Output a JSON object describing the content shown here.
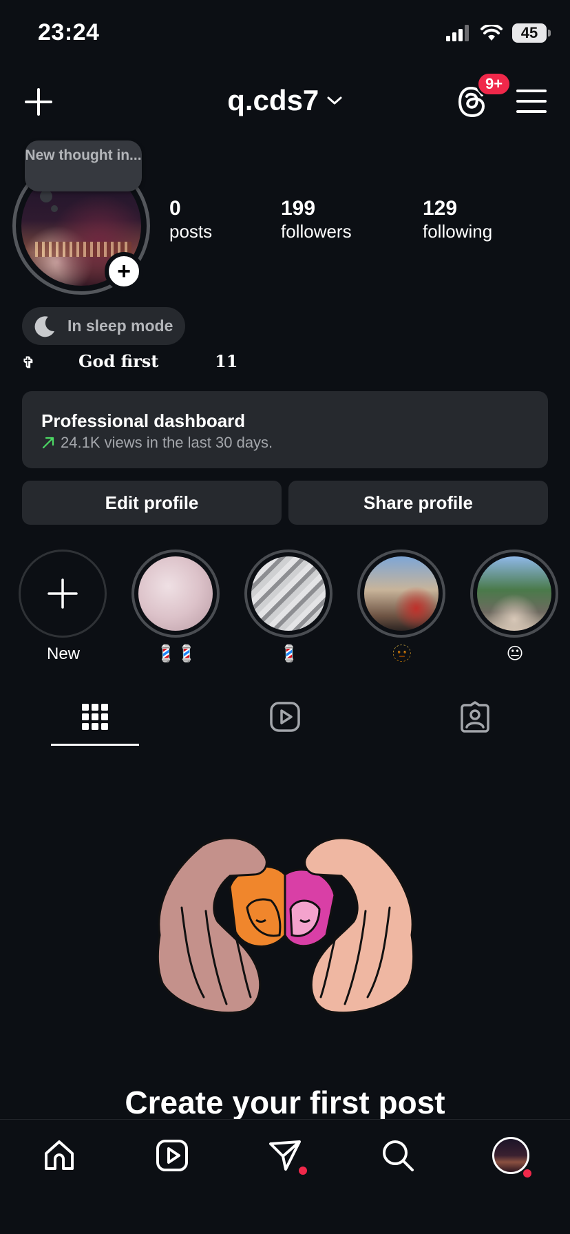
{
  "status_bar": {
    "time": "23:24",
    "battery": "45"
  },
  "header": {
    "username": "q.cds7",
    "notification_badge": "9+"
  },
  "profile": {
    "note": "New thought in...",
    "stats": [
      {
        "value": "0",
        "label": "posts"
      },
      {
        "value": "199",
        "label": "followers"
      },
      {
        "value": "129",
        "label": "following"
      }
    ],
    "sleep_mode": "In sleep mode",
    "bio": {
      "cross": "✞",
      "text": "God first",
      "number": "11"
    }
  },
  "dashboard": {
    "title": "Professional dashboard",
    "subtitle": "24.1K views in the last 30 days.",
    "accent": "#4cd964"
  },
  "buttons": {
    "edit": "Edit profile",
    "share": "Share profile"
  },
  "highlights": [
    {
      "label": "New",
      "kind": "new"
    },
    {
      "label": "💈💈",
      "kind": "image"
    },
    {
      "label": "💈",
      "kind": "image"
    },
    {
      "label": "🫥",
      "kind": "image"
    },
    {
      "label": "😐",
      "kind": "image"
    }
  ],
  "tabs": [
    "grid-icon",
    "reels-icon",
    "tagged-icon"
  ],
  "empty_state": {
    "title": "Create your first post"
  },
  "bottom_nav": [
    "home-icon",
    "reels-icon",
    "messages-icon",
    "search-icon",
    "profile-avatar"
  ],
  "colors": {
    "background": "#0c0f14",
    "surface": "#26292e",
    "badge": "#f0284a"
  }
}
